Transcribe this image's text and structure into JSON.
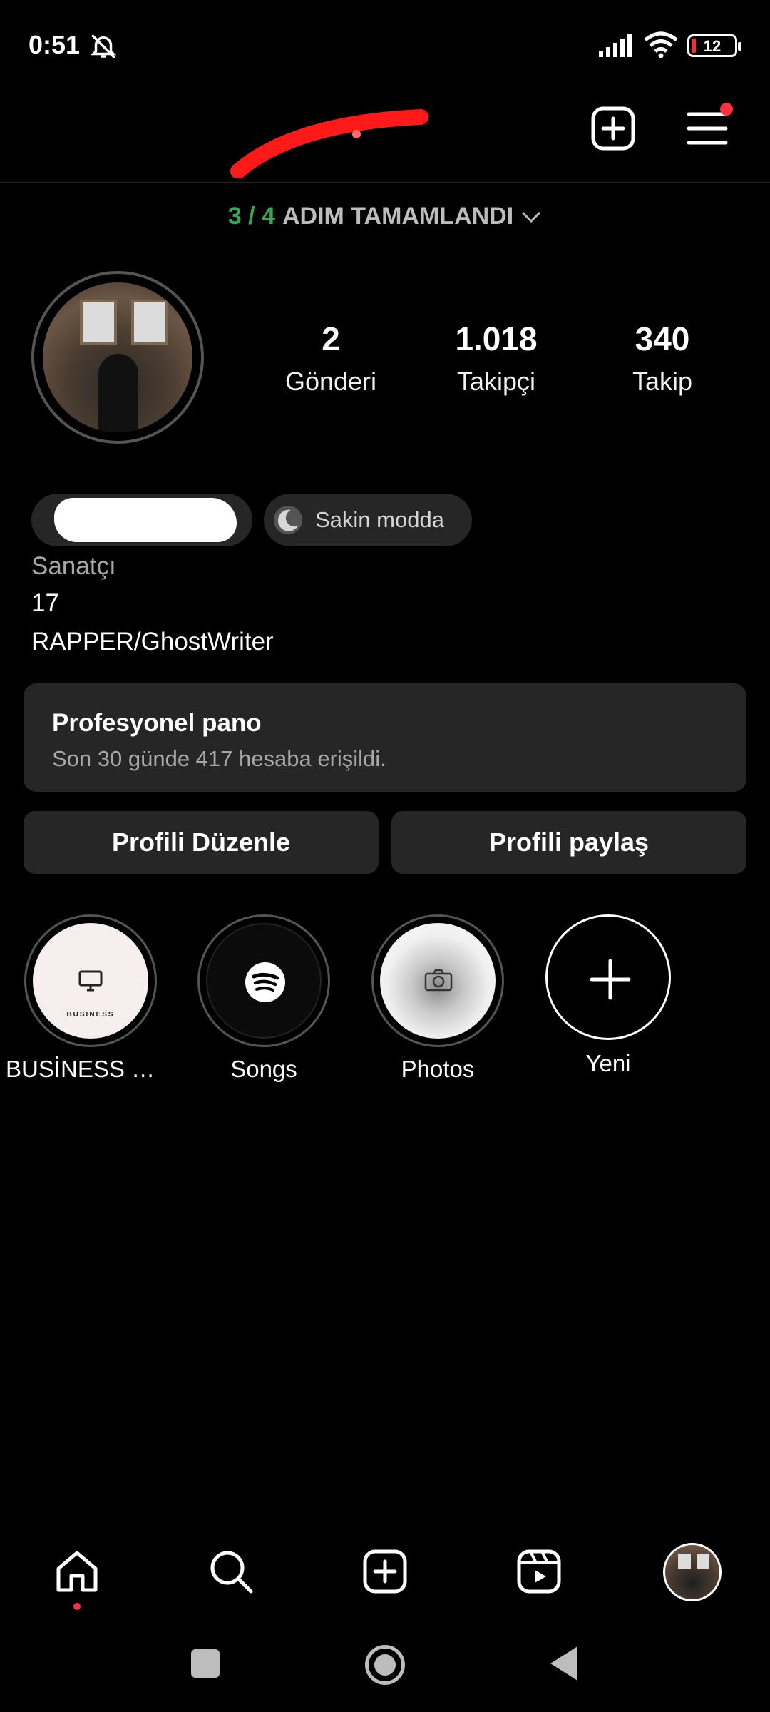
{
  "status_bar": {
    "time": "0:51",
    "battery": "12"
  },
  "steps": {
    "progress": "3 / 4",
    "label": "ADIM TAMAMLANDI"
  },
  "profile": {
    "stats": [
      {
        "value": "2",
        "label": "Gönderi"
      },
      {
        "value": "1.018",
        "label": "Takipçi"
      },
      {
        "value": "340",
        "label": "Takip"
      }
    ],
    "quiet_mode_label": "Sakin modda",
    "category": "Sanatçı",
    "bio_lines": [
      "17",
      "RAPPER/GhostWriter"
    ]
  },
  "dashboard": {
    "title": "Profesyonel pano",
    "subtitle": "Son 30 günde 417 hesaba erişildi."
  },
  "buttons": {
    "edit": "Profili Düzenle",
    "share": "Profili paylaş"
  },
  "highlights": [
    {
      "label": "BUSİNESS 🔪...",
      "cover_text": "BUSINESS"
    },
    {
      "label": "Songs"
    },
    {
      "label": "Photos"
    },
    {
      "label": "Yeni"
    }
  ],
  "colors": {
    "accent_green": "#3aa655",
    "notification_red": "#ff3040",
    "card_bg": "#262626"
  }
}
